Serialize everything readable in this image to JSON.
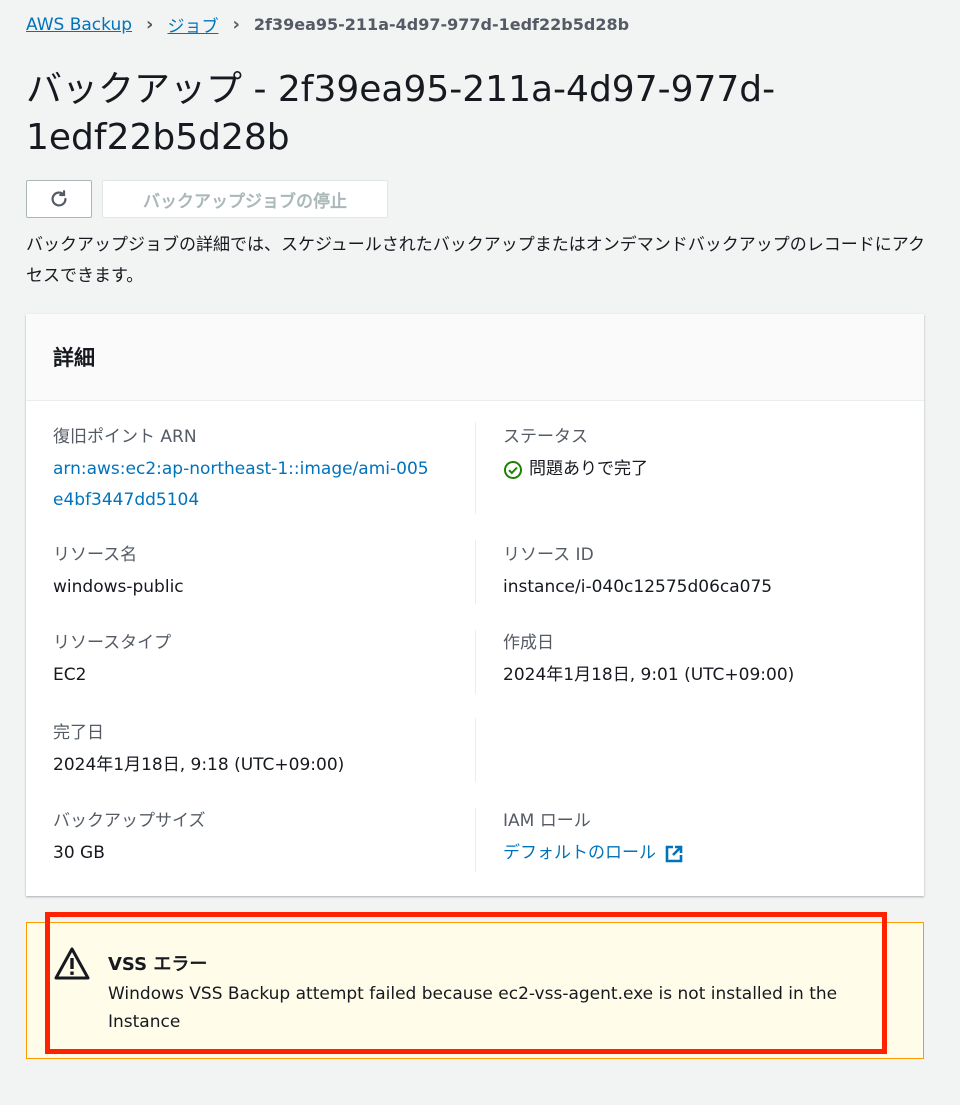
{
  "breadcrumb": {
    "items": [
      "AWS Backup",
      "ジョブ"
    ],
    "current": "2f39ea95-211a-4d97-977d-1edf22b5d28b"
  },
  "page": {
    "title": "バックアップ - 2f39ea95-211a-4d97-977d-1edf22b5d28b",
    "description": "バックアップジョブの詳細では、スケジュールされたバックアップまたはオンデマンドバックアップのレコードにアクセスできます。"
  },
  "actions": {
    "refresh_icon": "refresh-icon",
    "stop_label": "バックアップジョブの停止"
  },
  "details": {
    "title": "詳細",
    "recovery_point_arn_label": "復旧ポイント ARN",
    "recovery_point_arn": "arn:aws:ec2:ap-northeast-1::image/ami-005e4bf3447dd5104",
    "status_label": "ステータス",
    "status": "問題ありで完了",
    "resource_name_label": "リソース名",
    "resource_name": "windows-public",
    "resource_id_label": "リソース ID",
    "resource_id": "instance/i-040c12575d06ca075",
    "resource_type_label": "リソースタイプ",
    "resource_type": "EC2",
    "created_label": "作成日",
    "created": "2024年1月18日, 9:01 (UTC+09:00)",
    "completed_label": "完了日",
    "completed": "2024年1月18日, 9:18 (UTC+09:00)",
    "backup_size_label": "バックアップサイズ",
    "backup_size": "30 GB",
    "iam_role_label": "IAM ロール",
    "iam_role": "デフォルトのロール"
  },
  "alert": {
    "title": "VSS エラー",
    "message": "Windows VSS Backup attempt failed because ec2-vss-agent.exe is not installed in the Instance"
  },
  "colors": {
    "link": "#0073bb",
    "success": "#1d8102",
    "warning_border": "#ff9900",
    "highlight": "#ff2200"
  }
}
